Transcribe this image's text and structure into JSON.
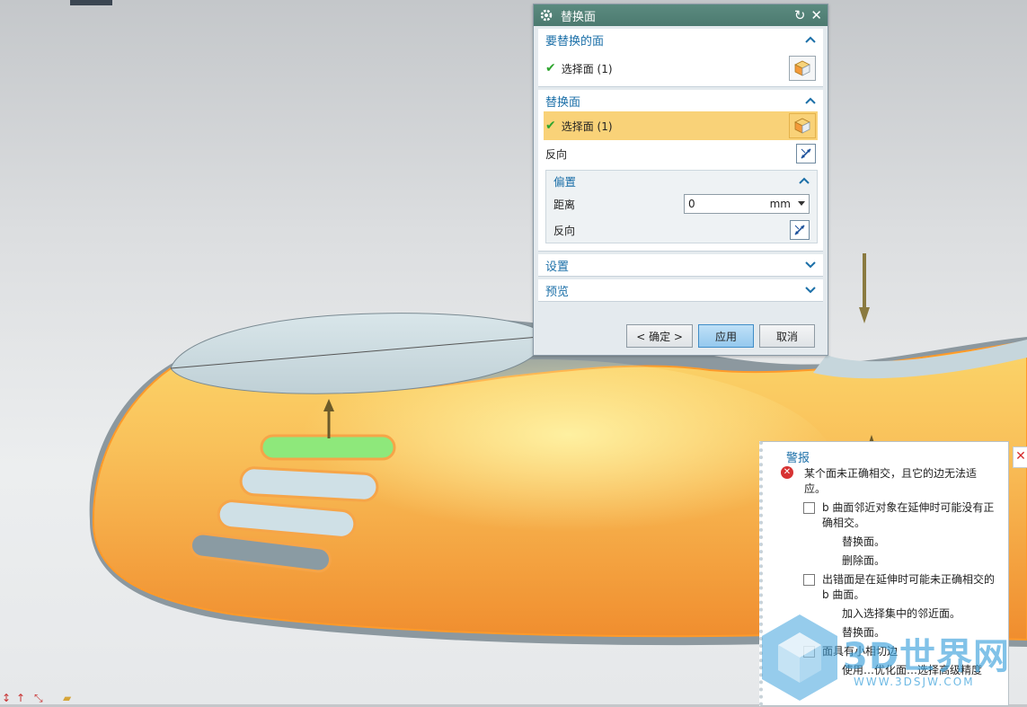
{
  "dialog": {
    "title": "替换面",
    "group_faces_to_replace": {
      "title": "要替换的面",
      "select_label": "选择面 (1)"
    },
    "group_replacement_face": {
      "title": "替换面",
      "select_label": "选择面 (1)",
      "reverse_label": "反向"
    },
    "group_offset": {
      "title": "偏置",
      "distance_label": "距离",
      "distance_value": "0",
      "distance_unit": "mm",
      "reverse_label": "反向"
    },
    "group_settings": {
      "title": "设置"
    },
    "group_preview": {
      "title": "预览"
    },
    "buttons": {
      "ok": "< 确定 >",
      "apply": "应用",
      "cancel": "取消"
    }
  },
  "alert": {
    "title": "警报",
    "error_message_line1": "某个面未正确相交，且它的边无法适",
    "error_message_line2": "应。",
    "item1_line1": "b 曲面邻近对象在延伸时可能没有正",
    "item1_line2": "确相交。",
    "item1_sub1": "替换面。",
    "item1_sub2": "删除面。",
    "item2_line1": "出错面是在延伸时可能未正确相交的",
    "item2_line2": "b 曲面。",
    "item2_sub1": "加入选择集中的邻近面。",
    "item2_sub2": "替换面。",
    "item3_line1": "面具有小相切边",
    "item3_sub1": "使用…优化面…选择高级精度"
  },
  "watermark": {
    "text": "3D世界网",
    "url": "WWW.3DSJW.COM"
  },
  "colors": {
    "title_bar": "#4f7d73",
    "group_title": "#1b6fa8",
    "selected_row": "#f9d278",
    "model_orange": "#f6a548",
    "model_top": "#cfdde2",
    "highlight_slot": "#8fe67a",
    "error_red": "#d73333"
  }
}
